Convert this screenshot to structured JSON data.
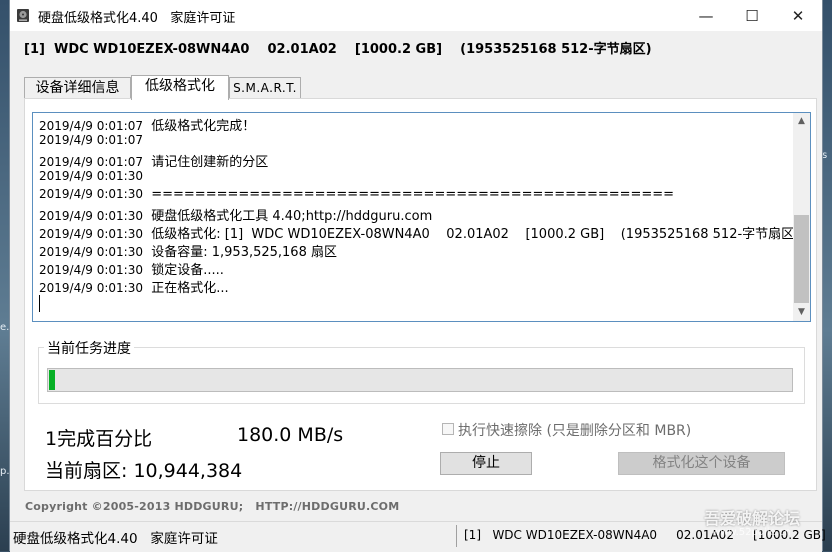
{
  "window": {
    "title": "硬盘低级格式化4.40   家庭许可证",
    "controls": {
      "minimize": "—",
      "maximize": "☐",
      "close": "✕"
    }
  },
  "device_info": "[1]  WDC WD10EZEX-08WN4A0    02.01A02    [1000.2 GB]    (1953525168 512-字节扇区)",
  "tabs": [
    {
      "label": "设备详细信息",
      "active": false
    },
    {
      "label": "低级格式化",
      "active": true
    },
    {
      "label": "S.M.A.R.T.",
      "active": false
    }
  ],
  "log": [
    {
      "time": "2019/4/9 0:01:07",
      "text": "低级格式化完成！"
    },
    {
      "time": "2019/4/9 0:01:07",
      "text": ""
    },
    {
      "time": "2019/4/9 0:01:07",
      "text": "请记住创建新的分区"
    },
    {
      "time": "2019/4/9 0:01:30",
      "text": ""
    },
    {
      "time": "2019/4/9 0:01:30",
      "text": "================================================"
    },
    {
      "time": "2019/4/9 0:01:30",
      "text": "硬盘低级格式化工具 4.40;http://hddguru.com"
    },
    {
      "time": "2019/4/9 0:01:30",
      "text": "低级格式化: [1]  WDC WD10EZEX-08WN4A0    02.01A02    [1000.2 GB]    (1953525168 512-字节扇区)"
    },
    {
      "time": "2019/4/9 0:01:30",
      "text": "设备容量: 1,953,525,168 扇区"
    },
    {
      "time": "2019/4/9 0:01:30",
      "text": "锁定设备....."
    },
    {
      "time": "2019/4/9 0:01:30",
      "text": "正在格式化..."
    }
  ],
  "progress": {
    "label": "当前任务进度",
    "value_fraction": 0.01,
    "fill_color": "#06b025"
  },
  "stats": {
    "percent_text": "1完成百分比",
    "speed_text": "180.0 MB/s",
    "sector_text": "当前扇区: 10,944,384"
  },
  "quick_wipe": {
    "label": "执行快速擦除 (只是删除分区和 MBR)",
    "checked": false,
    "enabled": false
  },
  "buttons": {
    "stop": "停止",
    "format": "格式化这个设备"
  },
  "copyright": "Copyright ©2005-2013 HDDGURU;   HTTP://HDDGURU.COM",
  "status_bar": {
    "left": "硬盘低级格式化4.40   家庭许可证",
    "right": "[1]   WDC WD10EZEX-08WN4A0     02.01A02     [1000.2 GB]"
  },
  "watermark": {
    "text": "吾爱破解论坛",
    "url": "www.52pojie.cn"
  },
  "desktop_clip": {
    "left_a": "e.",
    "left_b": "p.",
    "right_a": "s"
  }
}
